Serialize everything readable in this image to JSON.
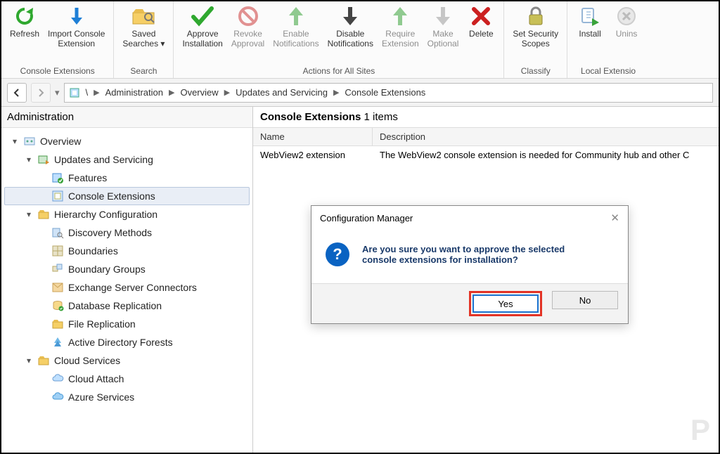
{
  "ribbon": {
    "groups": [
      {
        "label": "Console Extensions",
        "items": [
          {
            "id": "refresh",
            "label": "Refresh"
          },
          {
            "id": "import-console-extension",
            "label": "Import Console\nExtension"
          }
        ]
      },
      {
        "label": "Search",
        "items": [
          {
            "id": "saved-searches",
            "label": "Saved\nSearches ▾"
          }
        ]
      },
      {
        "label": "Actions for All Sites",
        "items": [
          {
            "id": "approve-installation",
            "label": "Approve\nInstallation"
          },
          {
            "id": "revoke-approval",
            "label": "Revoke\nApproval",
            "dim": true
          },
          {
            "id": "enable-notifications",
            "label": "Enable\nNotifications",
            "dim": true
          },
          {
            "id": "disable-notifications",
            "label": "Disable\nNotifications"
          },
          {
            "id": "require-extension",
            "label": "Require\nExtension",
            "dim": true
          },
          {
            "id": "make-optional",
            "label": "Make\nOptional",
            "dim": true
          },
          {
            "id": "delete",
            "label": "Delete"
          }
        ]
      },
      {
        "label": "Classify",
        "items": [
          {
            "id": "set-security-scopes",
            "label": "Set Security\nScopes"
          }
        ]
      },
      {
        "label": "Local Extensio",
        "items": [
          {
            "id": "install",
            "label": "Install"
          },
          {
            "id": "uninstall",
            "label": "Unins"
          }
        ]
      }
    ]
  },
  "breadcrumb": {
    "segments": [
      "\\",
      "Administration",
      "Overview",
      "Updates and Servicing",
      "Console Extensions"
    ]
  },
  "sidebar": {
    "title": "Administration",
    "tree": [
      {
        "depth": 1,
        "twisty": "▾",
        "icon": "overview",
        "label": "Overview"
      },
      {
        "depth": 2,
        "twisty": "▾",
        "icon": "updates",
        "label": "Updates and Servicing"
      },
      {
        "depth": 3,
        "twisty": "",
        "icon": "features",
        "label": "Features"
      },
      {
        "depth": 3,
        "twisty": "",
        "icon": "console-ext",
        "label": "Console Extensions",
        "selected": true
      },
      {
        "depth": 2,
        "twisty": "▾",
        "icon": "folder",
        "label": "Hierarchy Configuration"
      },
      {
        "depth": 3,
        "twisty": "",
        "icon": "discovery",
        "label": "Discovery Methods"
      },
      {
        "depth": 3,
        "twisty": "",
        "icon": "boundaries",
        "label": "Boundaries"
      },
      {
        "depth": 3,
        "twisty": "",
        "icon": "boundary-groups",
        "label": "Boundary Groups"
      },
      {
        "depth": 3,
        "twisty": "",
        "icon": "exchange",
        "label": "Exchange Server Connectors"
      },
      {
        "depth": 3,
        "twisty": "",
        "icon": "db-repl",
        "label": "Database Replication"
      },
      {
        "depth": 3,
        "twisty": "",
        "icon": "file-repl",
        "label": "File Replication"
      },
      {
        "depth": 3,
        "twisty": "",
        "icon": "ad-forests",
        "label": "Active Directory Forests"
      },
      {
        "depth": 2,
        "twisty": "▾",
        "icon": "folder",
        "label": "Cloud Services"
      },
      {
        "depth": 3,
        "twisty": "",
        "icon": "cloud-attach",
        "label": "Cloud Attach"
      },
      {
        "depth": 3,
        "twisty": "",
        "icon": "azure",
        "label": "Azure Services"
      }
    ]
  },
  "list": {
    "title_prefix": "Console Extensions",
    "count_suffix": "1 items",
    "columns": {
      "name": "Name",
      "description": "Description"
    },
    "rows": [
      {
        "name": "WebView2 extension",
        "description": "The WebView2 console extension is needed for Community hub and other C"
      }
    ]
  },
  "dialog": {
    "title": "Configuration Manager",
    "message": "Are you sure you want to approve the selected console extensions for installation?",
    "yes": "Yes",
    "no": "No"
  },
  "watermark": "P"
}
